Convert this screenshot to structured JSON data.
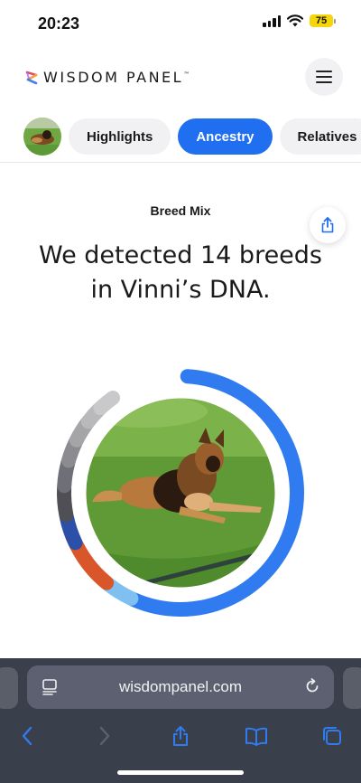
{
  "status": {
    "time": "20:23",
    "battery": "75"
  },
  "header": {
    "logo_text": "WISDOM PANEL",
    "logo_mark": "™"
  },
  "tabs": [
    {
      "label": "Highlights",
      "active": false
    },
    {
      "label": "Ancestry",
      "active": true
    },
    {
      "label": "Relatives",
      "active": false
    }
  ],
  "content": {
    "section_label": "Breed Mix",
    "headline_line1": "We detected 14 breeds",
    "headline_line2": "in Vinni’s DNA."
  },
  "breed_ring": {
    "segments": [
      {
        "color": "#2f7bef",
        "fraction": 0.56
      },
      {
        "color": "#7fc0f0",
        "fraction": 0.04
      },
      {
        "color": "#d9562b",
        "fraction": 0.07
      },
      {
        "color": "#2c4fa8",
        "fraction": 0.04
      },
      {
        "color": "#4f4f55",
        "fraction": 0.04
      },
      {
        "color": "#6f7077",
        "fraction": 0.035
      },
      {
        "color": "#8c8c90",
        "fraction": 0.03
      },
      {
        "color": "#a5a5a8",
        "fraction": 0.03
      },
      {
        "color": "#b9b9bb",
        "fraction": 0.025
      },
      {
        "color": "#c9c9cb",
        "fraction": 0.025
      }
    ]
  },
  "browser": {
    "url": "wisdompanel.com"
  },
  "icons": {
    "wifi": "wifi-icon",
    "signal": "signal-icon",
    "menu": "hamburger-menu-icon",
    "share": "share-icon",
    "reader": "reader-mode-icon",
    "reload": "reload-icon",
    "back": "back-chevron-icon",
    "forward": "forward-chevron-icon",
    "bookmarks": "bookmarks-icon",
    "tabs": "tabs-icon"
  },
  "colors": {
    "accent": "#1f6ff0",
    "browser_bg": "#3a3f4c",
    "battery": "#f5d60a"
  }
}
